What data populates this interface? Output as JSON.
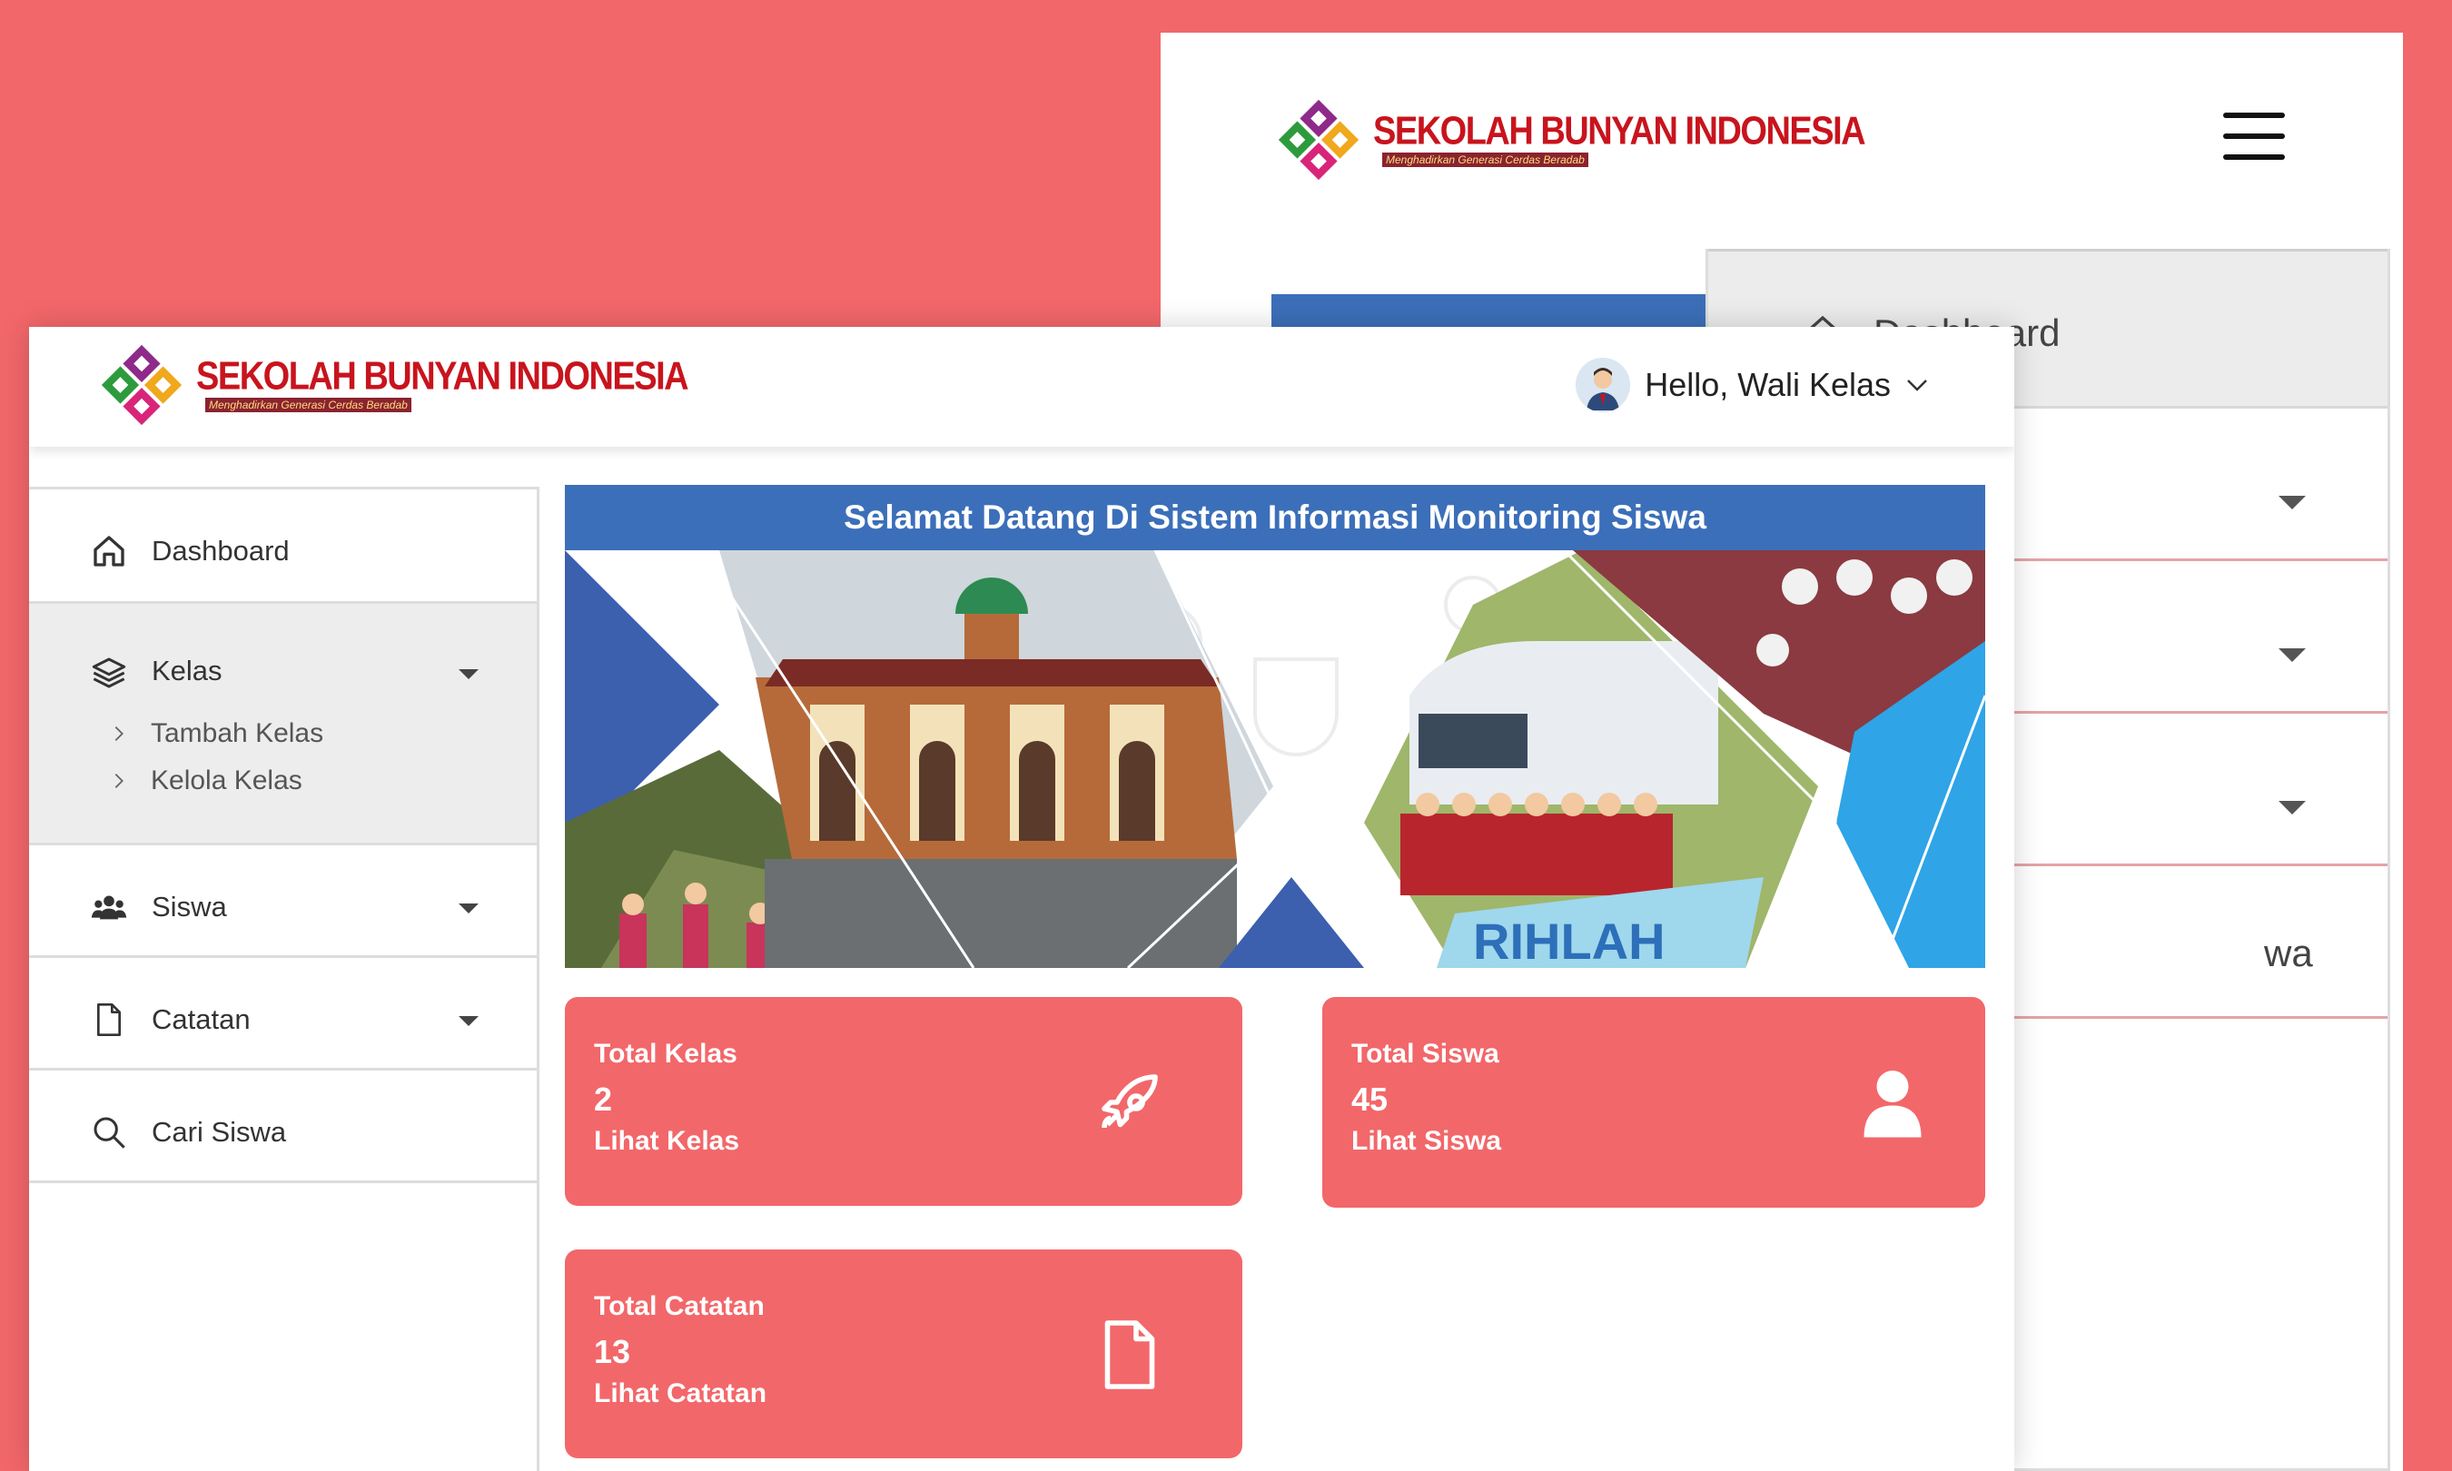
{
  "brand": {
    "name": "SEKOLAH BUNYAN INDONESIA",
    "tagline": "Menghadirkan Generasi Cerdas Beradab",
    "colors": {
      "accent": "#f2676a",
      "primary": "#3c6fb9",
      "brand_red": "#c8141d"
    }
  },
  "back_window": {
    "menu": [
      {
        "label": "Dashboard"
      },
      {
        "label": ""
      },
      {
        "label": ""
      },
      {
        "label": ""
      },
      {
        "label": "wa"
      }
    ]
  },
  "header": {
    "greeting": "Hello, Wali Kelas",
    "avatar_icon": "user-avatar-icon",
    "dropdown_icon": "chevron-down-icon"
  },
  "sidebar": {
    "items": [
      {
        "label": "Dashboard",
        "icon": "home-icon"
      },
      {
        "label": "Kelas",
        "icon": "layers-icon",
        "children": [
          "Tambah Kelas",
          "Kelola Kelas"
        ]
      },
      {
        "label": "Siswa",
        "icon": "users-icon"
      },
      {
        "label": "Catatan",
        "icon": "document-icon"
      },
      {
        "label": "Cari Siswa",
        "icon": "search-icon"
      }
    ]
  },
  "banner": {
    "title": "Selamat Datang Di Sistem Informasi Monitoring Siswa",
    "photo_text": "RIHLAH"
  },
  "cards": [
    {
      "label": "Total Kelas",
      "value": "2",
      "link": "Lihat Kelas",
      "icon": "rocket-icon"
    },
    {
      "label": "Total Siswa",
      "value": "45",
      "link": "Lihat Siswa",
      "icon": "person-icon"
    },
    {
      "label": "Total Catatan",
      "value": "13",
      "link": "Lihat Catatan",
      "icon": "file-icon"
    }
  ]
}
